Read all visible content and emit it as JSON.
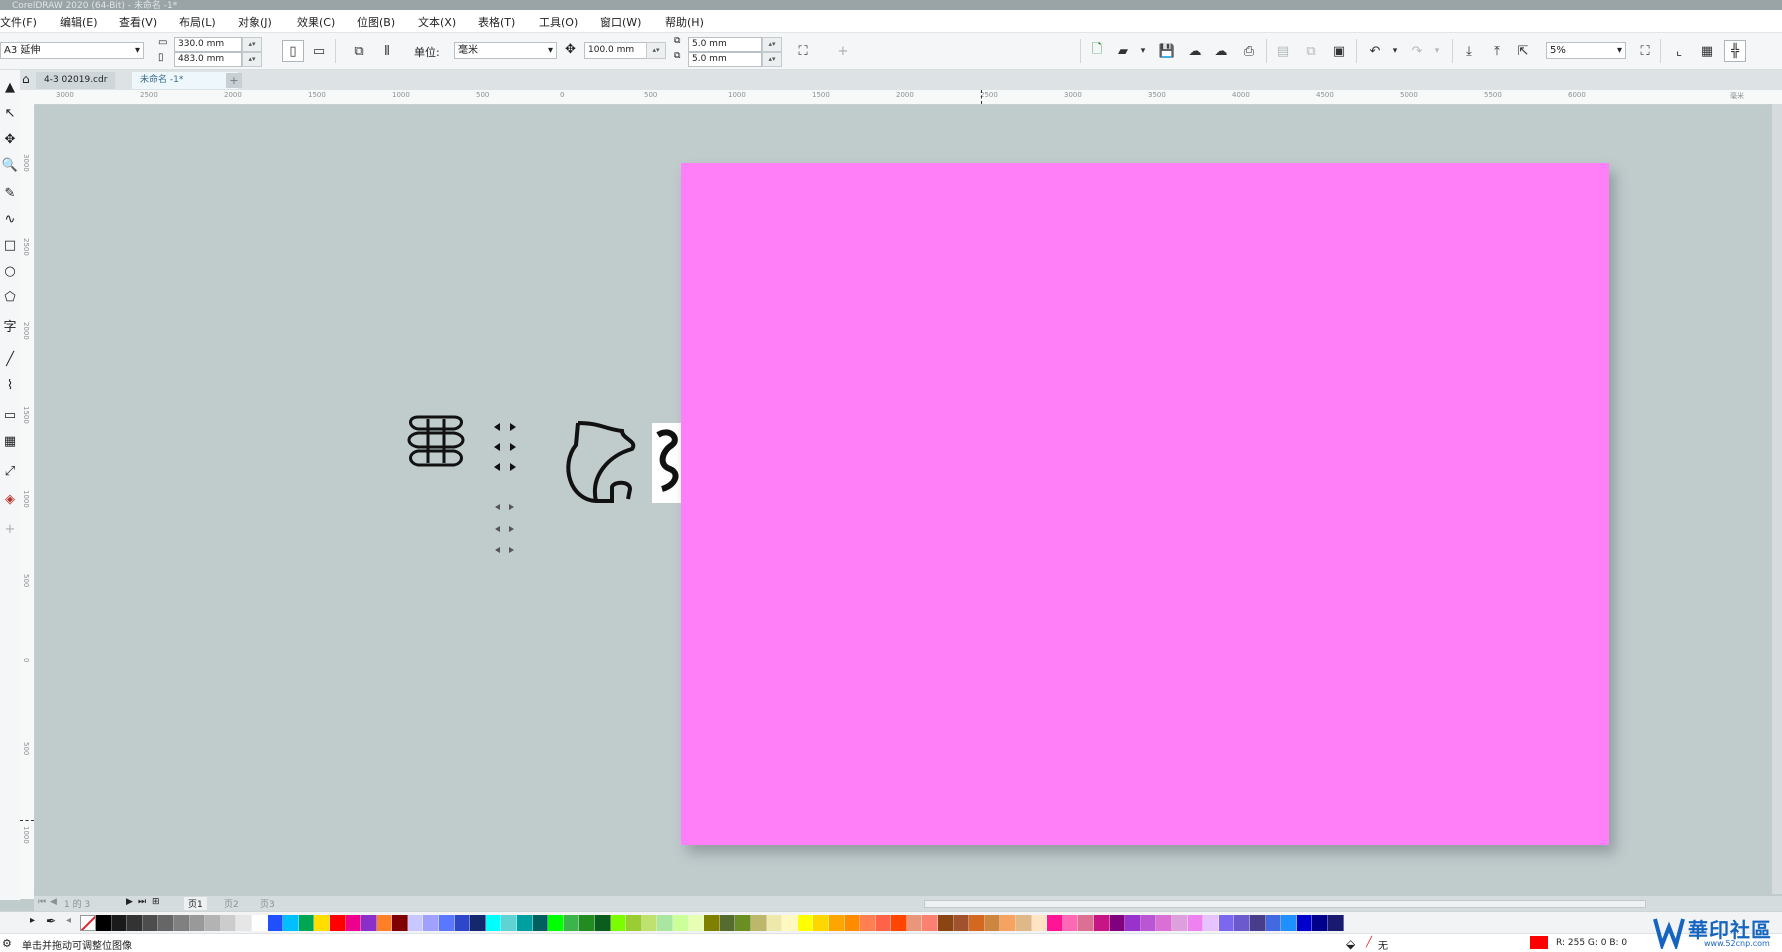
{
  "window": {
    "title": "CorelDRAW 2020 (64-Bit) - 未命名 -1*"
  },
  "menu": {
    "items": [
      "文件(F)",
      "编辑(E)",
      "查看(V)",
      "布局(L)",
      "对象(J)",
      "效果(C)",
      "位图(B)",
      "文本(X)",
      "表格(T)",
      "工具(O)",
      "窗口(W)",
      "帮助(H)"
    ]
  },
  "property_bar": {
    "page_size": "A3 延伸",
    "width": "330.0 mm",
    "height": "483.0 mm",
    "unit_label": "单位:",
    "unit_value": "毫米",
    "nudge": "100.0 mm",
    "dup_x": "5.0 mm",
    "dup_y": "5.0 mm",
    "zoom": "5%"
  },
  "tabs": [
    {
      "label": "4-3 02019.cdr"
    },
    {
      "label": "未命名 -1*"
    }
  ],
  "ruler": {
    "h_ticks": [
      "3000",
      "2500",
      "2000",
      "1500",
      "1000",
      "500",
      "0",
      "500",
      "1000",
      "1500",
      "2000",
      "2500",
      "3000",
      "3500",
      "4000",
      "4500",
      "5000",
      "5500",
      "6000",
      "毫米"
    ],
    "v_ticks": [
      "3000",
      "2500",
      "2000",
      "1500",
      "1000",
      "500",
      "0",
      "500",
      "1000",
      "1500",
      "2000"
    ]
  },
  "tools": [
    "▲",
    "↖",
    "✥",
    "🔍",
    "✎",
    "∿",
    "□",
    "○",
    "⬠",
    "字",
    "╱",
    "⌇",
    "▭",
    "▦",
    "⤢",
    "◈",
    "+"
  ],
  "page_nav": {
    "counter": "1 的 3",
    "pages": [
      "页1",
      "页2",
      "页3"
    ]
  },
  "palette": {
    "colors": [
      "#000000",
      "#1a1a1a",
      "#333333",
      "#4d4d4d",
      "#666666",
      "#808080",
      "#999999",
      "#b3b3b3",
      "#cccccc",
      "#e6e6e6",
      "#ffffff",
      "#1f4fff",
      "#00bfff",
      "#00a651",
      "#ffde00",
      "#ff0000",
      "#ec008c",
      "#8b2fc9",
      "#ff7f27",
      "#7f0000",
      "#c8c8ff",
      "#a0a0ff",
      "#5a78ff",
      "#2e46c8",
      "#14286e",
      "#00ffff",
      "#5fd3d3",
      "#00a0a0",
      "#006060",
      "#00ff00",
      "#3cb44b",
      "#228b22",
      "#0b5d1e",
      "#7cfc00",
      "#9acd32",
      "#c0e070",
      "#a8e6a1",
      "#ccff99",
      "#e6ffb3",
      "#808000",
      "#556b2f",
      "#6b8e23",
      "#bdb76b",
      "#eee8aa",
      "#fff8c0",
      "#ffff00",
      "#ffd700",
      "#ffa500",
      "#ff8c00",
      "#ff7f50",
      "#ff6347",
      "#ff4500",
      "#e9967a",
      "#fa8072",
      "#8b4513",
      "#a0522d",
      "#d2691e",
      "#cd853f",
      "#f4a460",
      "#deb887",
      "#ffe4c4",
      "#ff1493",
      "#ff69b4",
      "#db7093",
      "#c71585",
      "#800080",
      "#9932cc",
      "#ba55d3",
      "#da70d6",
      "#dda0dd",
      "#ee82ee",
      "#e6c3ff",
      "#7b68ee",
      "#6a5acd",
      "#483d8b",
      "#4169e1",
      "#1e90ff",
      "#0000cd",
      "#00008b",
      "#191970"
    ]
  },
  "status": {
    "hint": "单击并拖动可调整位图像",
    "fill_label": "无",
    "color_readout": "R: 255 G: 0 B: 0"
  },
  "watermark": {
    "cn": "華印社區",
    "url": "www.52cnp.com"
  },
  "colors": {
    "page": "#ff7ff9",
    "canvas": "#c0cbcc",
    "accent": "#1565c0"
  }
}
